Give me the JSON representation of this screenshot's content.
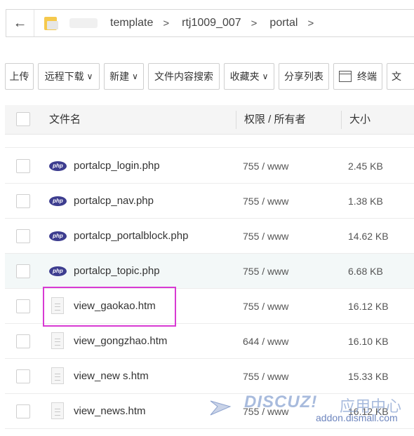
{
  "breadcrumb": {
    "items": [
      "template",
      "rtj1009_007",
      "portal"
    ],
    "separator": ">"
  },
  "toolbar": {
    "upload": "上传",
    "remote_download": "远程下载",
    "new": "新建",
    "content_search": "文件内容搜索",
    "favorites": "收藏夹",
    "share_list": "分享列表",
    "terminal": "终端",
    "more": "文",
    "caret": "∨"
  },
  "table": {
    "headers": {
      "name": "文件名",
      "perm": "权限 / 所有者",
      "size": "大小"
    },
    "rows": [
      {
        "name": "portalcp_login.php",
        "type": "php",
        "perm": "755 / www",
        "size": "2.45 KB"
      },
      {
        "name": "portalcp_nav.php",
        "type": "php",
        "perm": "755 / www",
        "size": "1.38 KB"
      },
      {
        "name": "portalcp_portalblock.php",
        "type": "php",
        "perm": "755 / www",
        "size": "14.62 KB"
      },
      {
        "name": "portalcp_topic.php",
        "type": "php",
        "perm": "755 / www",
        "size": "6.68 KB"
      },
      {
        "name": "view_gaokao.htm",
        "type": "htm",
        "perm": "755 / www",
        "size": "16.12 KB"
      },
      {
        "name": "view_gongzhao.htm",
        "type": "htm",
        "perm": "644 / www",
        "size": "16.10 KB"
      },
      {
        "name": "view_new s.htm",
        "type": "htm",
        "perm": "755 / www",
        "size": "15.33 KB"
      },
      {
        "name": "view_news.htm",
        "type": "htm",
        "perm": "755 / www",
        "size": "16.12 KB"
      }
    ],
    "php_icon_text": "php"
  },
  "watermark": {
    "logo": "DISCUZ!",
    "cn": "应用中心",
    "url": "addon.dismall.com"
  },
  "colors": {
    "highlight": "#d83ad3",
    "hover_row": "#f3f8f8",
    "php_icon": "#3d3d8f",
    "folder": "#f5c94d"
  }
}
